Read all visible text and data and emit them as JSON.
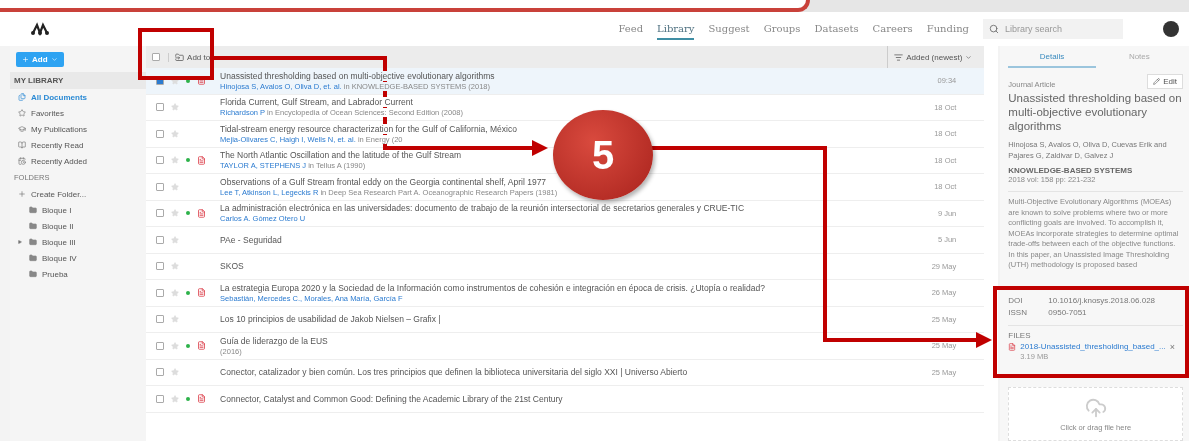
{
  "nav": {
    "items": [
      {
        "label": "Feed",
        "selected": false
      },
      {
        "label": "Library",
        "selected": true
      },
      {
        "label": "Suggest",
        "selected": false
      },
      {
        "label": "Groups",
        "selected": false
      },
      {
        "label": "Datasets",
        "selected": false
      },
      {
        "label": "Careers",
        "selected": false
      },
      {
        "label": "Funding",
        "selected": false
      }
    ],
    "search": {
      "placeholder": "Library search"
    }
  },
  "sidebar": {
    "add_button": "Add",
    "header": "MY LIBRARY",
    "items": [
      {
        "label": "All Documents",
        "kind": "documents",
        "selected": true
      },
      {
        "label": "Favorites",
        "kind": "star",
        "selected": false
      },
      {
        "label": "My Publications",
        "kind": "publications",
        "selected": false
      },
      {
        "label": "Recently Read",
        "kind": "read",
        "selected": false
      },
      {
        "label": "Recently Added",
        "kind": "added",
        "selected": false
      }
    ],
    "folders_header": "FOLDERS",
    "create_folder": "Create Folder...",
    "folders": [
      {
        "label": "Bloque I",
        "expandable": false
      },
      {
        "label": "Bloque II",
        "expandable": false
      },
      {
        "label": "Bloque III",
        "expandable": true
      },
      {
        "label": "Bloque IV",
        "expandable": false
      },
      {
        "label": "Prueba",
        "expandable": false
      }
    ]
  },
  "toolbar": {
    "select_all_checked": false,
    "add_to": "Add to",
    "sort": "Added (newest)"
  },
  "documents": [
    {
      "title": "Unassisted thresholding based on multi-objective evolutionary algorithms",
      "authors": "Hinojosa S, Avalos O, Oliva D, et. al.",
      "source": "in KNOWLEDGE-BASED SYSTEMS (2018)",
      "date": "09:34",
      "checked": true,
      "selected": true,
      "starred": false,
      "unread": true,
      "pdf": true
    },
    {
      "title": "Florida Current, Gulf Stream, and Labrador Current",
      "authors": "Richardson P",
      "source": "in Encyclopedia of Ocean Sciences: Second Edition (2008)",
      "date": "18 Oct",
      "checked": false,
      "selected": false,
      "starred": false,
      "unread": false,
      "pdf": false
    },
    {
      "title": "Tidal-stream energy resource characterization for the Gulf of California, México",
      "authors": "Mejia-Olivares C, Haigh I, Wells N, et. al.",
      "source": "in Energy (20",
      "date": "18 Oct",
      "checked": false,
      "selected": false,
      "starred": false,
      "unread": false,
      "pdf": false
    },
    {
      "title": "The North Atlantic Oscillation and the latitude of the Gulf Stream",
      "authors": "TAYLOR A, STEPHENS J",
      "source": "in Tellus A (1990)",
      "date": "18 Oct",
      "checked": false,
      "selected": false,
      "starred": false,
      "unread": true,
      "pdf": true
    },
    {
      "title": "Observations of a Gulf Stream frontal eddy on the Georgia continental shelf, April 1977",
      "authors": "Lee T, Atkinson L, Legeckis R",
      "source": "in Deep Sea Research Part A. Oceanographic Research Papers (1981)",
      "date": "18 Oct",
      "checked": false,
      "selected": false,
      "starred": false,
      "unread": false,
      "pdf": false
    },
    {
      "title": "La administración electrónica en las universidades: documento de trabajo de la reunión intersectorial de secretarios generales y CRUE-TIC",
      "authors": "Carlos A. Gómez Otero U",
      "date": "9 Jun",
      "checked": false,
      "selected": false,
      "starred": false,
      "unread": true,
      "pdf": true
    },
    {
      "title": "PAe - Seguridad",
      "date": "5 Jun",
      "checked": false,
      "selected": false,
      "starred": false,
      "unread": false,
      "pdf": false
    },
    {
      "title": "SKOS",
      "date": "29 May",
      "checked": false,
      "selected": false,
      "starred": false,
      "unread": false,
      "pdf": false
    },
    {
      "title": "La estrategia Europa 2020 y la Sociedad de la Información como instrumentos de cohesión e integración en época de crisis. ¿Utopía o realidad?",
      "authors": "Sebastián, Mercedes C., Morales, Ana María, García F",
      "date": "26 May",
      "checked": false,
      "selected": false,
      "starred": false,
      "unread": true,
      "pdf": true
    },
    {
      "title": "Los 10 principios de usabilidad de Jakob Nielsen – Grafix |",
      "date": "25 May",
      "checked": false,
      "selected": false,
      "starred": false,
      "unread": false,
      "pdf": false
    },
    {
      "title": "Guía de liderazgo de la EUS",
      "source": "(2016)",
      "date": "25 May",
      "checked": false,
      "selected": false,
      "starred": false,
      "unread": true,
      "pdf": true
    },
    {
      "title": "Conector, catalizador y bien común. Los tres principios que definen la biblioteca universitaria del siglo XXI | Universo Abierto",
      "date": "25 May",
      "checked": false,
      "selected": false,
      "starred": false,
      "unread": false,
      "pdf": false
    },
    {
      "title": "Connector, Catalyst and Common Good: Defining the Academic Library of the 21st Century",
      "checked": false,
      "selected": false,
      "starred": false,
      "unread": true,
      "pdf": true
    }
  ],
  "details": {
    "tabs": [
      {
        "label": "Details",
        "selected": true
      },
      {
        "label": "Notes",
        "selected": false
      }
    ],
    "edit": "Edit",
    "type": "Journal Article",
    "title": "Unassisted thresholding based on multi-objective evolutionary algorithms",
    "authors": "Hinojosa S,  Avalos O,  Oliva D,  Cuevas Erik and Pajares G,  Zaldivar D,  Galvez J",
    "journal": "KNOWLEDGE-BASED SYSTEMS",
    "volume": "2018 vol: 158 pp: 221-232",
    "abstract": "Multi-Objective Evolutionary Algorithms (MOEAs) are known to solve problems where two or more conflicting goals are involved. To accomplish it, MOEAs incorporate strategies to determine optimal trade-offs between each of the objective functions. In this paper, an Unassisted Image Thresholding (UTH) methodology is proposed based",
    "identifiers": [
      {
        "label": "DOI",
        "value": "10.1016/j.knosys.2018.06.028"
      },
      {
        "label": "ISSN",
        "value": "0950-7051"
      }
    ],
    "files_header": "FILES",
    "file": {
      "name": "2018-Unassisted_thresholding_based_...",
      "size": "3.19 MB",
      "remove": "×"
    },
    "drop_zone": "Click or drag file here"
  },
  "annotation": {
    "step": "5"
  }
}
